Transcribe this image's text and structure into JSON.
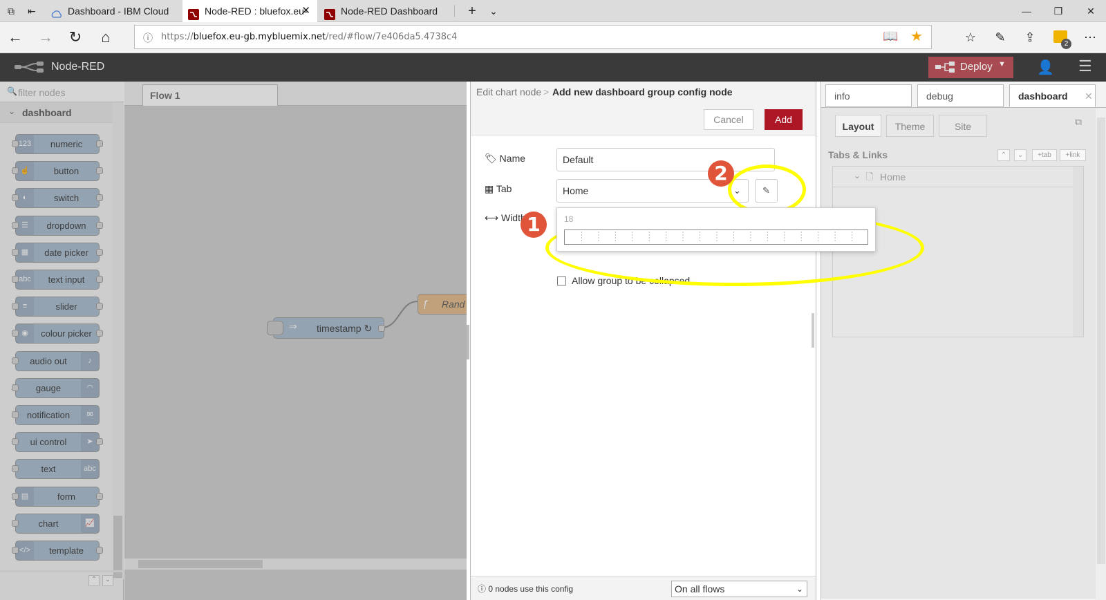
{
  "browser": {
    "tabs": [
      {
        "title": "Dashboard - IBM Cloud"
      },
      {
        "title": "Node-RED : bluefox.eu-"
      },
      {
        "title": "Node-RED Dashboard"
      }
    ],
    "url_prefix": "https://",
    "url_host": "bluefox.eu-gb.mybluemix.net",
    "url_path": "/red/#flow/7e406da5.4738c4",
    "notification_count": "2"
  },
  "header": {
    "app_title": "Node-RED",
    "deploy_label": "Deploy"
  },
  "palette": {
    "filter_placeholder": "filter nodes",
    "category": "dashboard",
    "nodes": [
      {
        "label": "numeric",
        "icon": "123"
      },
      {
        "label": "button",
        "icon": "hand"
      },
      {
        "label": "switch",
        "icon": "toggle"
      },
      {
        "label": "dropdown",
        "icon": "list"
      },
      {
        "label": "date picker",
        "icon": "calendar"
      },
      {
        "label": "text input",
        "icon": "abc"
      },
      {
        "label": "slider",
        "icon": "sliders"
      },
      {
        "label": "colour picker",
        "icon": "palette"
      },
      {
        "label": "audio out",
        "icon": "audio"
      },
      {
        "label": "gauge",
        "icon": "gauge"
      },
      {
        "label": "notification",
        "icon": "envelope"
      },
      {
        "label": "ui control",
        "icon": "arrow"
      },
      {
        "label": "text",
        "icon": "abc"
      },
      {
        "label": "form",
        "icon": "form"
      },
      {
        "label": "chart",
        "icon": "chart"
      },
      {
        "label": "template",
        "icon": "code"
      }
    ]
  },
  "workspace": {
    "flow_tab": "Flow 1",
    "nodes": {
      "timestamp": "timestamp ↻",
      "function_partial": "Rand"
    }
  },
  "tray": {
    "breadcrumb_parent": "Edit chart node",
    "breadcrumb_sep": ">",
    "title": "Add new dashboard group config node",
    "cancel": "Cancel",
    "add": "Add",
    "name_label": "Name",
    "name_value": "Default",
    "tab_label": "Tab",
    "tab_value": "Home",
    "width_label": "Width",
    "width_value": "18",
    "collapse_label": "Allow group to be collapsed",
    "footer_usage": "0 nodes use this config",
    "footer_scope": "On all flows"
  },
  "sidebar": {
    "tabs": [
      "info",
      "debug",
      "dashboard"
    ],
    "layout_tabs": [
      "Layout",
      "Theme",
      "Site"
    ],
    "section_title": "Tabs & Links",
    "btn_tab": "+tab",
    "btn_link": "+link",
    "tree_item": "Home"
  },
  "annotations": {
    "badge1": "1",
    "badge2": "2",
    "highlight_color": "#ffff00",
    "badge_color": "#e0553a"
  }
}
